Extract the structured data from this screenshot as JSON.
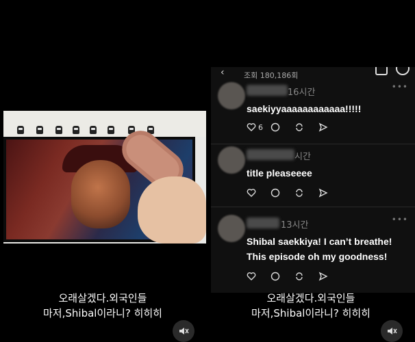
{
  "left_panel": {
    "caption_line1": "오래살겠다.외국인들",
    "caption_line2": "마저,Shibal이라니? 히히히"
  },
  "right_panel": {
    "caption_line1": "오래살겠다.외국인들",
    "caption_line2": "마저,Shibal이라니? 히히히",
    "app": {
      "views": "조회 180,186회",
      "comments": [
        {
          "time": "16시간",
          "text": "saekiyyaaaaaaaaaaaa!!!!!",
          "likes": "6"
        },
        {
          "time": "시간",
          "text": "title pleaseeee",
          "likes": ""
        },
        {
          "time": "13시간",
          "text_line1": "Shibal saekkiya! I can’t breathe!",
          "text_line2": "This episode oh my goodness!",
          "likes": ""
        }
      ]
    }
  },
  "colors": {
    "background": "#000000",
    "app_background": "#101010",
    "text": "#ffffff",
    "muted": "#888888"
  },
  "icons": [
    "mute-icon",
    "heart-icon",
    "comment-icon",
    "repost-icon",
    "share-icon",
    "more-icon",
    "back-icon",
    "bell-icon"
  ]
}
